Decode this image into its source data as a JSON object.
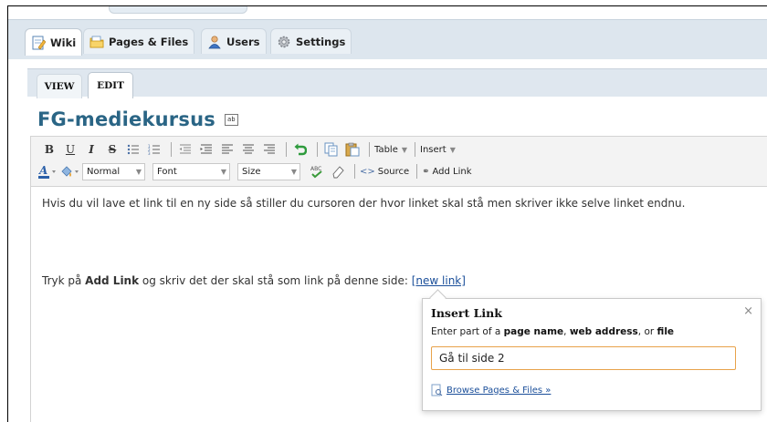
{
  "top_tabs": [
    {
      "label": "Wiki",
      "icon": "wiki-icon",
      "active": true
    },
    {
      "label": "Pages & Files",
      "icon": "folder-icon",
      "active": false
    },
    {
      "label": "Users",
      "icon": "users-icon",
      "active": false
    },
    {
      "label": "Settings",
      "icon": "gear-icon",
      "active": false
    }
  ],
  "sub_tabs": {
    "view": "VIEW",
    "edit": "EDIT"
  },
  "page": {
    "title": "FG-mediekursus",
    "rename_icon_text": "ab"
  },
  "toolbar": {
    "row1": {
      "bold": "B",
      "underline": "U",
      "italic": "I",
      "strike": "S",
      "table": "Table",
      "insert": "Insert"
    },
    "row2": {
      "format": "Normal",
      "font": "Font",
      "size": "Size",
      "source": "Source",
      "add_link": "Add Link"
    }
  },
  "editor": {
    "line1": "Hvis du vil lave et link til en ny side så stiller du cursoren der hvor linket skal stå men skriver ikke selve linket endnu.",
    "line2_before": "Tryk på ",
    "line2_bold": "Add Link",
    "line2_after": " og skriv det der skal stå som link på denne side: ",
    "new_link": "[new link]"
  },
  "insert_link_popup": {
    "title": "Insert Link",
    "close": "×",
    "hint_prefix": "Enter part of a ",
    "hint_page": "page name",
    "hint_sep1": ", ",
    "hint_web": "web address",
    "hint_sep2": ", or ",
    "hint_file": "file",
    "input_value": "Gå til side 2",
    "browse": "Browse Pages & Files »"
  },
  "colors": {
    "title": "#2a6585",
    "accent_input_border": "#e8a24a",
    "link": "#1b4f9a"
  }
}
